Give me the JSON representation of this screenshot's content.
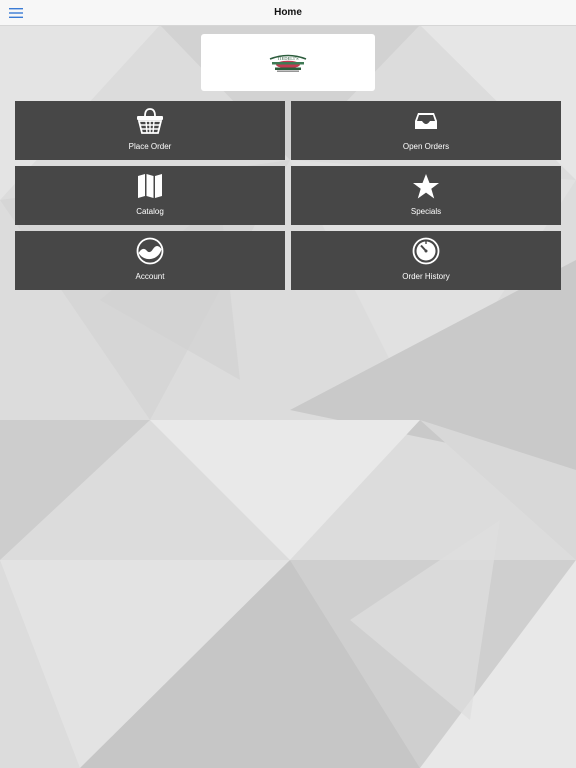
{
  "header": {
    "title": "Home",
    "menu_icon": "hamburger-menu-icon"
  },
  "logo": {
    "text": "TIEDELT'S"
  },
  "tiles": [
    {
      "label": "Place Order",
      "icon": "basket-icon"
    },
    {
      "label": "Open Orders",
      "icon": "inbox-tray-icon"
    },
    {
      "label": "Catalog",
      "icon": "map-icon"
    },
    {
      "label": "Specials",
      "icon": "star-icon"
    },
    {
      "label": "Account",
      "icon": "account-landscape-icon"
    },
    {
      "label": "Order History",
      "icon": "clock-icon"
    }
  ],
  "colors": {
    "header_bg": "#f7f7f7",
    "menu_accent": "#3a7bd5",
    "tile_bg": "#474747",
    "tile_text": "#ffffff"
  }
}
